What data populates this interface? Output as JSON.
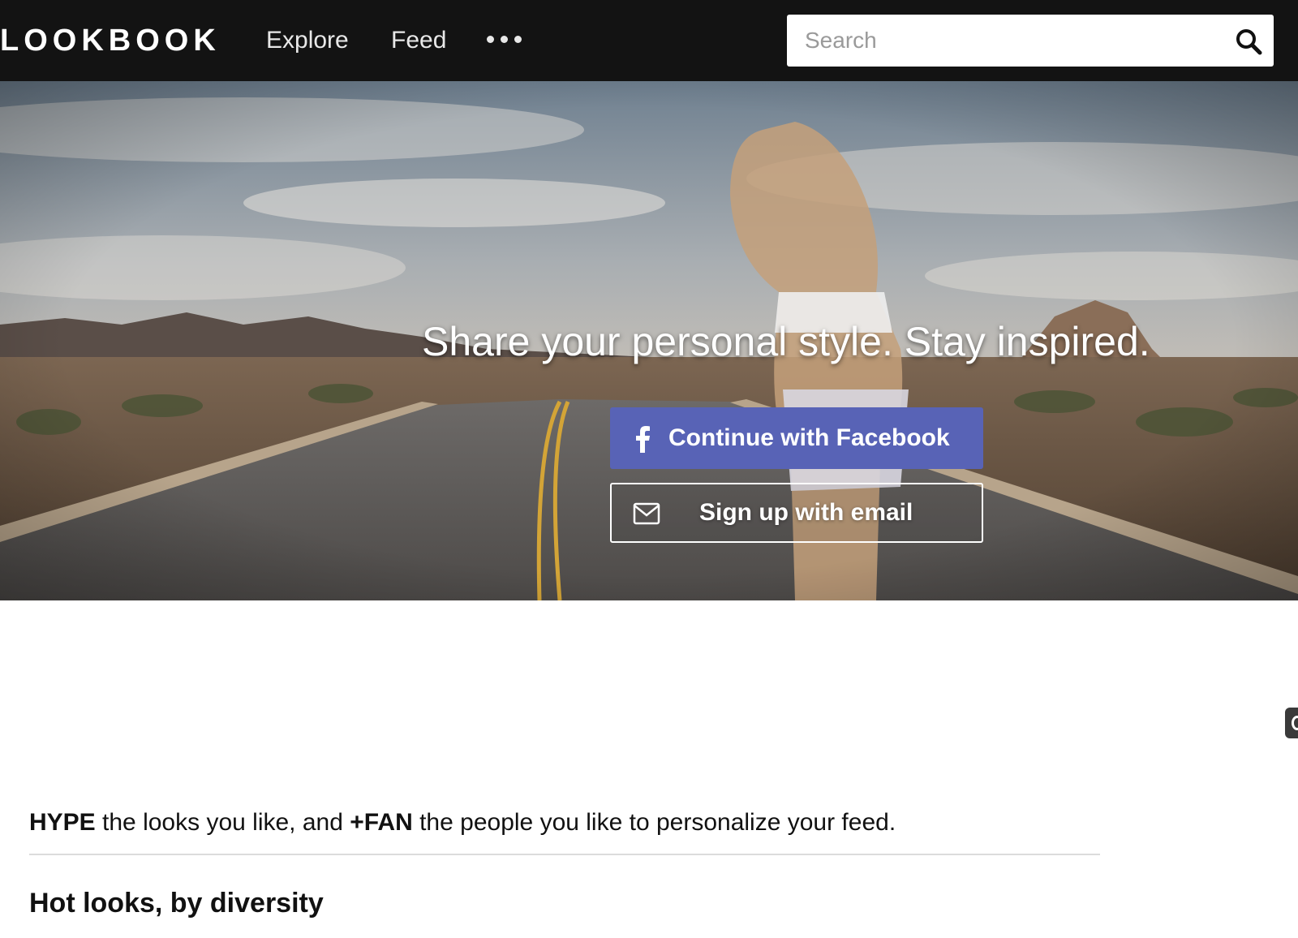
{
  "nav": {
    "logo": "LOOKBOOK",
    "links": [
      {
        "label": "Explore"
      },
      {
        "label": "Feed"
      }
    ],
    "more_icon": "more-dots-icon",
    "search": {
      "placeholder": "Search",
      "value": "",
      "icon": "search-icon"
    }
  },
  "hero": {
    "title": "Share your personal style. Stay inspired.",
    "facebook_button": {
      "label": "Continue with Facebook",
      "icon": "facebook-icon",
      "color": "#5863b6"
    },
    "email_button": {
      "label": "Sign up with email",
      "icon": "mail-icon"
    }
  },
  "intro": {
    "hype": "HYPE",
    "text_1": " the looks you like, and ",
    "fan": "+FAN",
    "text_2": " the people you like to personalize your feed."
  },
  "section": {
    "title": "Hot looks, by diversity"
  },
  "colors": {
    "topbar": "#131313",
    "accent": "#5863b6"
  }
}
